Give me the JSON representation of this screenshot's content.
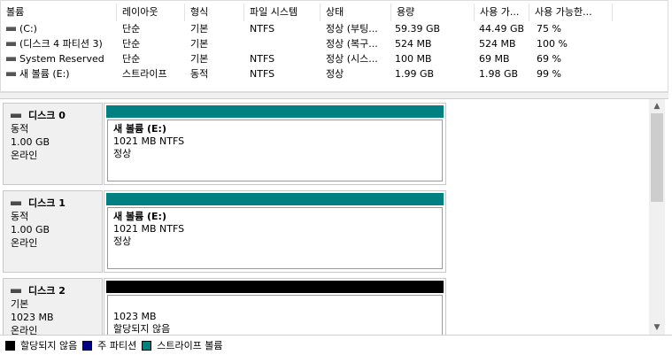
{
  "volume_list": {
    "columns": [
      "볼륨",
      "레이아웃",
      "형식",
      "파일 시스템",
      "상태",
      "용량",
      "사용 가...",
      "사용 가능한..."
    ],
    "rows": [
      {
        "volume": "(C:)",
        "layout": "단순",
        "type": "기본",
        "fs": "NTFS",
        "status": "정상 (부팅...",
        "capacity": "59.39 GB",
        "free": "44.49 GB",
        "pct": "75 %"
      },
      {
        "volume": "(디스크 4 파티션 3)",
        "layout": "단순",
        "type": "기본",
        "fs": "",
        "status": "정상 (복구...",
        "capacity": "524 MB",
        "free": "524 MB",
        "pct": "100 %"
      },
      {
        "volume": "System Reserved",
        "layout": "단순",
        "type": "기본",
        "fs": "NTFS",
        "status": "정상 (시스...",
        "capacity": "100 MB",
        "free": "69 MB",
        "pct": "69 %"
      },
      {
        "volume": "새 볼륨 (E:)",
        "layout": "스트라이프",
        "type": "동적",
        "fs": "NTFS",
        "status": "정상",
        "capacity": "1.99 GB",
        "free": "1.98 GB",
        "pct": "99 %"
      }
    ]
  },
  "disks": [
    {
      "name": "디스크 0",
      "type": "동적",
      "size": "1.00 GB",
      "state": "온라인",
      "partition": {
        "bar_color": "#008080",
        "title": "새 볼륨  (E:)",
        "line2": "1021 MB NTFS",
        "line3": "정상"
      }
    },
    {
      "name": "디스크 1",
      "type": "동적",
      "size": "1.00 GB",
      "state": "온라인",
      "partition": {
        "bar_color": "#008080",
        "title": "새 볼륨  (E:)",
        "line2": "1021 MB NTFS",
        "line3": "정상"
      }
    },
    {
      "name": "디스크 2",
      "type": "기본",
      "size": "1023 MB",
      "state": "온라인",
      "partition": {
        "bar_color": "#000000",
        "title": "",
        "line2": "1023 MB",
        "line3": "할당되지 않음"
      }
    }
  ],
  "legend": [
    {
      "label": "할당되지 않음",
      "color": "#000000"
    },
    {
      "label": "주 파티션",
      "color": "#000080"
    },
    {
      "label": "스트라이프 볼륨",
      "color": "#008080"
    }
  ],
  "scrollbar": {
    "up_icon": "▲",
    "down_icon": "▼"
  }
}
